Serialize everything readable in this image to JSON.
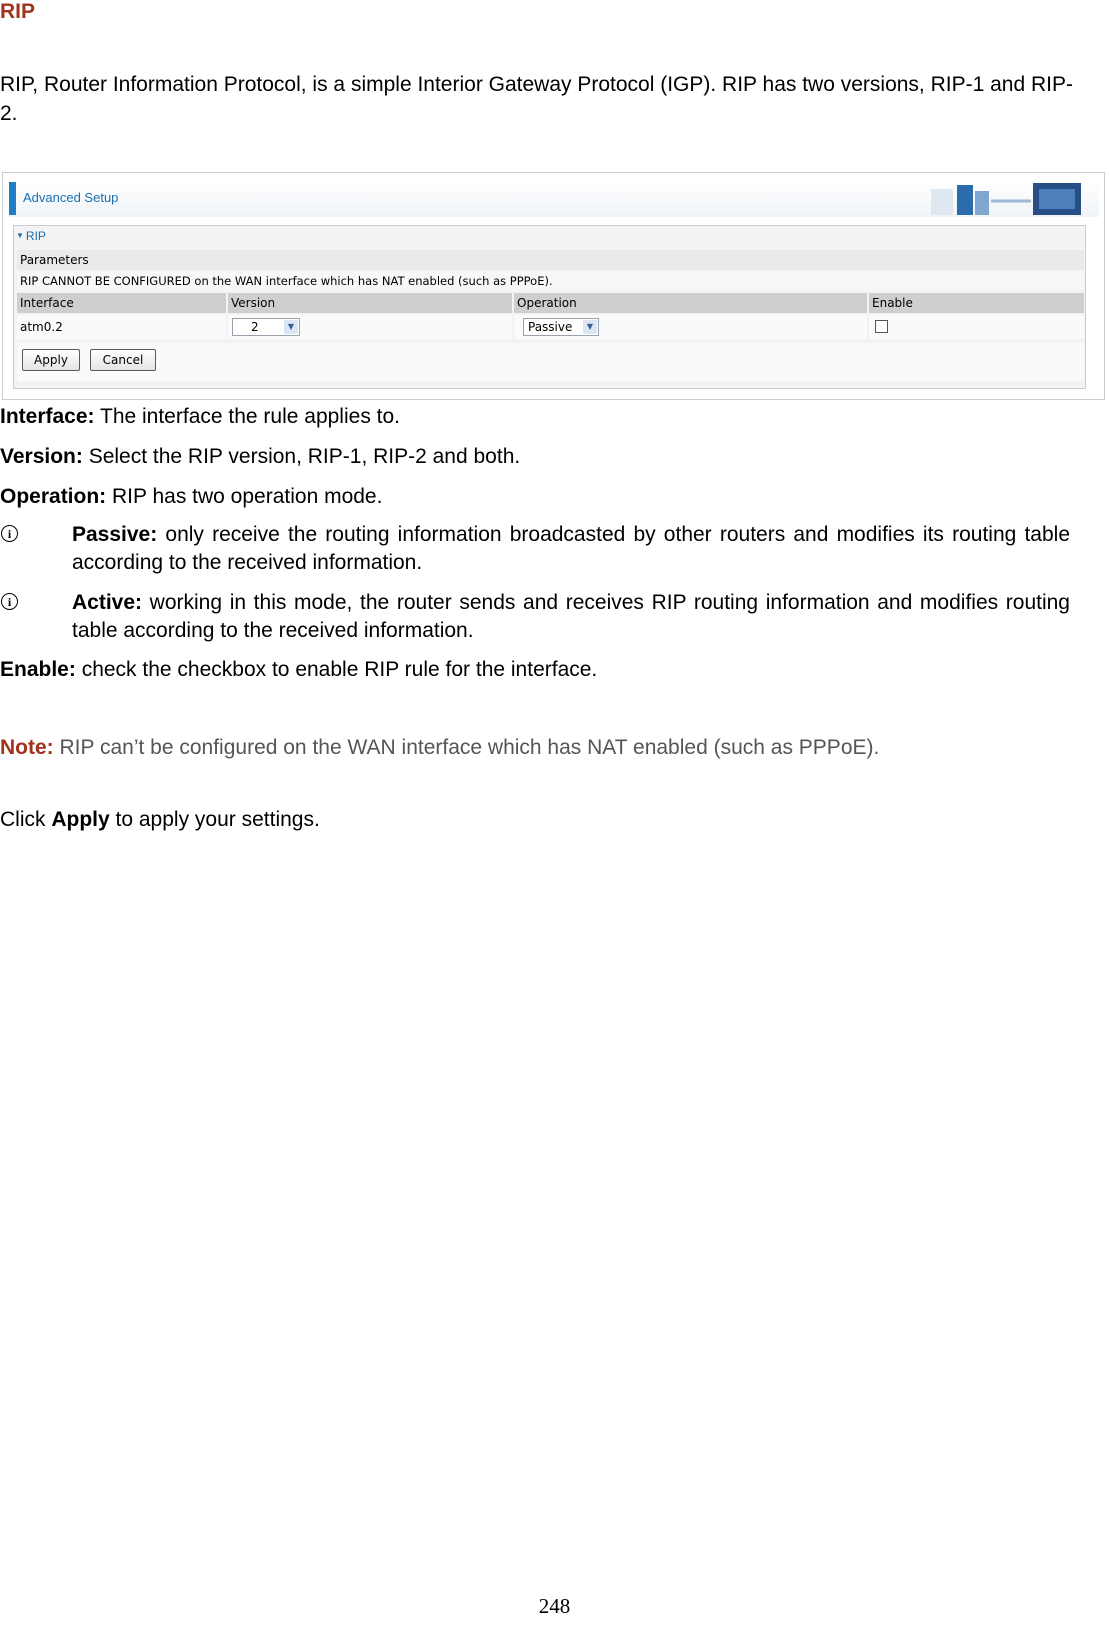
{
  "heading": "RIP",
  "intro": "RIP, Router Information Protocol, is a simple Interior Gateway Protocol (IGP). RIP has two versions, RIP-1 and RIP-2.",
  "ui": {
    "header_title": "Advanced Setup",
    "section_title": "RIP",
    "parameters_label": "Parameters",
    "warning": "RIP CANNOT BE CONFIGURED on the WAN interface which has NAT enabled (such as PPPoE).",
    "columns": [
      "Interface",
      "Version",
      "Operation",
      "Enable"
    ],
    "row": {
      "interface": "atm0.2",
      "version": "2",
      "operation": "Passive",
      "enable_checked": false
    },
    "apply_label": "Apply",
    "cancel_label": "Cancel",
    "accent_color": "#1f7fc2"
  },
  "descriptions": {
    "interface": {
      "term": "Interface:",
      "text": " The interface the rule applies to."
    },
    "version": {
      "term": "Version:",
      "text": " Select the RIP version, RIP-1, RIP-2 and both."
    },
    "operation": {
      "term": "Operation:",
      "text": " RIP has two operation mode."
    },
    "passive": {
      "term": "Passive:",
      "text": " only receive the routing information broadcasted by other routers and modifies its routing table according to the received information."
    },
    "active": {
      "term": "Active:",
      "text": " working in this mode, the router sends and receives RIP routing information and modifies routing table according to the received information."
    },
    "enable": {
      "term": "Enable:",
      "text": " check the checkbox to enable RIP rule for the interface."
    }
  },
  "note": {
    "label": "Note:",
    "text": " RIP can’t be configured on the WAN interface which has NAT enabled (such as PPPoE)."
  },
  "click": {
    "prefix": "Click ",
    "emphasis": "Apply",
    "suffix": " to apply your settings."
  },
  "page_number": "248",
  "icons": {
    "bullet": "info-icon",
    "dropdown": "chevron-down-icon",
    "section_toggle": "triangle-down-icon"
  }
}
